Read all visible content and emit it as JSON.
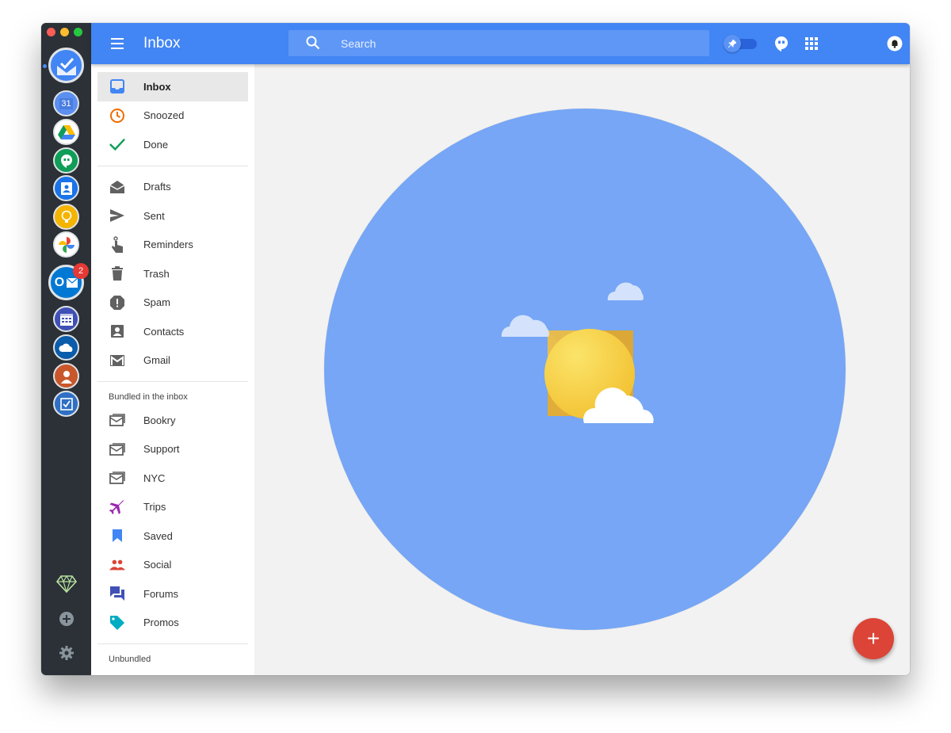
{
  "window": {
    "traffic_lights": [
      "close",
      "minimize",
      "zoom"
    ]
  },
  "dock": {
    "apps": [
      {
        "name": "inbox-app-icon",
        "color": "#4285f4"
      },
      {
        "name": "calendar-app-icon",
        "label": "31",
        "color": "#4285f4"
      },
      {
        "name": "drive-app-icon",
        "color": "#fbbc04"
      },
      {
        "name": "hangouts-app-icon",
        "color": "#0f9d58"
      },
      {
        "name": "contacts-app-icon",
        "color": "#1a73e8"
      },
      {
        "name": "keep-app-icon",
        "color": "#f4b400"
      },
      {
        "name": "photos-app-icon",
        "color": "#ea4335"
      },
      {
        "name": "outlook-app-icon",
        "label": "O",
        "color": "#0078d4"
      },
      {
        "name": "outlook-calendar-app-icon",
        "color": "#3f51b5"
      },
      {
        "name": "onedrive-app-icon",
        "color": "#0b5cab"
      },
      {
        "name": "people-app-icon",
        "color": "#c8572b"
      },
      {
        "name": "todo-app-icon",
        "color": "#2f6fc4"
      }
    ],
    "outlook_badge": "2",
    "bottom": [
      "sketch-icon",
      "add-app-icon",
      "settings-icon"
    ]
  },
  "header": {
    "title": "Inbox",
    "search_placeholder": "Search",
    "accent": "#4285f4",
    "icons": [
      "pin-toggle-icon",
      "hangouts-icon",
      "apps-grid-icon",
      "notifications-icon"
    ]
  },
  "nav": {
    "primary": [
      {
        "label": "Inbox",
        "icon": "inbox-icon",
        "color": "#4285f4"
      },
      {
        "label": "Snoozed",
        "icon": "clock-icon",
        "color": "#ef6c00"
      },
      {
        "label": "Done",
        "icon": "checkmark-icon",
        "color": "#0f9d58"
      }
    ],
    "secondary": [
      {
        "label": "Drafts",
        "icon": "drafts-icon"
      },
      {
        "label": "Sent",
        "icon": "send-icon"
      },
      {
        "label": "Reminders",
        "icon": "reminder-icon"
      },
      {
        "label": "Trash",
        "icon": "trash-icon"
      },
      {
        "label": "Spam",
        "icon": "spam-icon"
      },
      {
        "label": "Contacts",
        "icon": "contacts-icon"
      },
      {
        "label": "Gmail",
        "icon": "gmail-icon"
      }
    ],
    "bundled_header": "Bundled in the inbox",
    "bundles": [
      {
        "label": "Bookry",
        "icon": "bundle-icon",
        "color": "#616161"
      },
      {
        "label": "Support",
        "icon": "bundle-icon",
        "color": "#616161"
      },
      {
        "label": "NYC",
        "icon": "bundle-icon",
        "color": "#616161"
      },
      {
        "label": "Trips",
        "icon": "plane-icon",
        "color": "#9c27b0"
      },
      {
        "label": "Saved",
        "icon": "bookmark-icon",
        "color": "#4285f4"
      },
      {
        "label": "Social",
        "icon": "social-icon",
        "color": "#db4437"
      },
      {
        "label": "Forums",
        "icon": "forums-icon",
        "color": "#3f51b5"
      },
      {
        "label": "Promos",
        "icon": "promos-icon",
        "color": "#00acc1"
      }
    ],
    "unbundled_header": "Unbundled"
  },
  "main": {
    "empty_state": "inbox-zero-sun-illustration",
    "sky_color": "#76a6f5",
    "fab_label": "+",
    "fab_color": "#db4437"
  }
}
